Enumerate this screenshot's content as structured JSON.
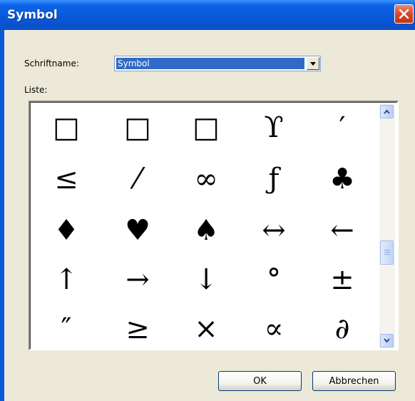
{
  "window": {
    "title": "Symbol"
  },
  "font": {
    "label": "Schriftname:",
    "selected": "Symbol"
  },
  "list": {
    "label": "Liste:",
    "symbols": [
      "□",
      "□",
      "□",
      "ϒ",
      "′",
      "≤",
      "⁄",
      "∞",
      "ƒ",
      "♣",
      "♦",
      "♥",
      "♠",
      "↔",
      "←",
      "↑",
      "→",
      "↓",
      "°",
      "±",
      "″",
      "≥",
      "×",
      "∝",
      "∂"
    ]
  },
  "buttons": {
    "ok": "OK",
    "cancel": "Abbrechen"
  },
  "colors": {
    "titlebar": "#0a58d8",
    "selection": "#316ac5",
    "dialog": "#ece9d8"
  }
}
